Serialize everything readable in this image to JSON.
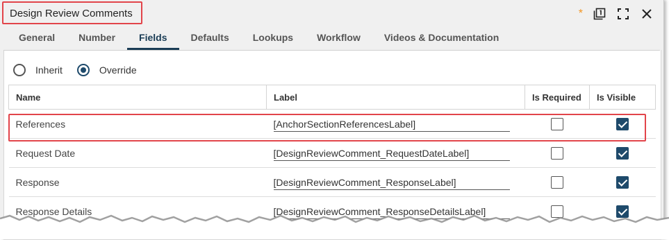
{
  "window": {
    "title": "Design Review Comments",
    "unsaved_marker": "*",
    "icons": [
      "popout-icon",
      "maximize-icon",
      "close-icon"
    ]
  },
  "tabs": [
    {
      "label": "General",
      "active": false
    },
    {
      "label": "Number",
      "active": false
    },
    {
      "label": "Fields",
      "active": true
    },
    {
      "label": "Defaults",
      "active": false
    },
    {
      "label": "Lookups",
      "active": false
    },
    {
      "label": "Workflow",
      "active": false
    },
    {
      "label": "Videos & Documentation",
      "active": false
    }
  ],
  "mode": {
    "options": [
      {
        "label": "Inherit",
        "selected": false
      },
      {
        "label": "Override",
        "selected": true
      }
    ]
  },
  "grid": {
    "columns": [
      "Name",
      "Label",
      "Is Required",
      "Is Visible"
    ],
    "rows": [
      {
        "name": "References",
        "label": "[AnchorSectionReferencesLabel]",
        "required": false,
        "visible": true,
        "highlighted": true
      },
      {
        "name": "Request Date",
        "label": "[DesignReviewComment_RequestDateLabel]",
        "required": false,
        "visible": true
      },
      {
        "name": "Response",
        "label": "[DesignReviewComment_ResponseLabel]",
        "required": false,
        "visible": true
      },
      {
        "name": "Response Details",
        "label": "[DesignReviewComment_ResponseDetailsLabel]",
        "required": false,
        "visible": true
      }
    ]
  },
  "colors": {
    "accent": "#1e4a6b",
    "highlight": "#e2444a",
    "unsaved": "#f29522"
  }
}
